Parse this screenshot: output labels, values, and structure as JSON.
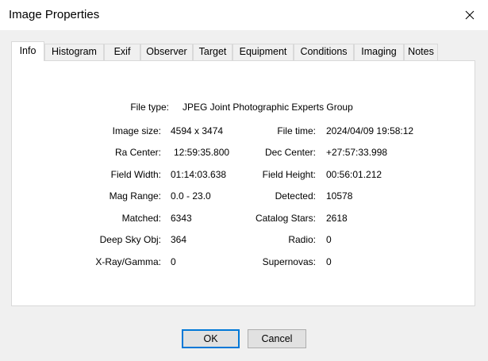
{
  "window": {
    "title": "Image Properties"
  },
  "tabs": [
    {
      "label": "Info"
    },
    {
      "label": "Histogram"
    },
    {
      "label": "Exif"
    },
    {
      "label": "Observer"
    },
    {
      "label": "Target"
    },
    {
      "label": "Equipment"
    },
    {
      "label": "Conditions"
    },
    {
      "label": "Imaging"
    },
    {
      "label": "Notes"
    }
  ],
  "info": {
    "file_type_label": "File type:",
    "file_type_value": "JPEG Joint Photographic Experts Group",
    "left": [
      {
        "label": "Image size:",
        "value": "4594 x 3474"
      },
      {
        "label": "Ra Center:",
        "value": "12:59:35.800"
      },
      {
        "label": "Field Width:",
        "value": "01:14:03.638"
      },
      {
        "label": "Mag Range:",
        "value": "0.0 - 23.0"
      },
      {
        "label": "Matched:",
        "value": "6343"
      },
      {
        "label": "Deep Sky Obj:",
        "value": "364"
      },
      {
        "label": "X-Ray/Gamma:",
        "value": "0"
      }
    ],
    "right": [
      {
        "label": "File time:",
        "value": "2024/04/09 19:58:12"
      },
      {
        "label": "Dec Center:",
        "value": "+27:57:33.998"
      },
      {
        "label": "Field Height:",
        "value": "00:56:01.212"
      },
      {
        "label": "Detected:",
        "value": "10578"
      },
      {
        "label": "Catalog Stars:",
        "value": "2618"
      },
      {
        "label": "Radio:",
        "value": "0"
      },
      {
        "label": "Supernovas:",
        "value": "0"
      }
    ]
  },
  "buttons": {
    "ok": "OK",
    "cancel": "Cancel"
  }
}
